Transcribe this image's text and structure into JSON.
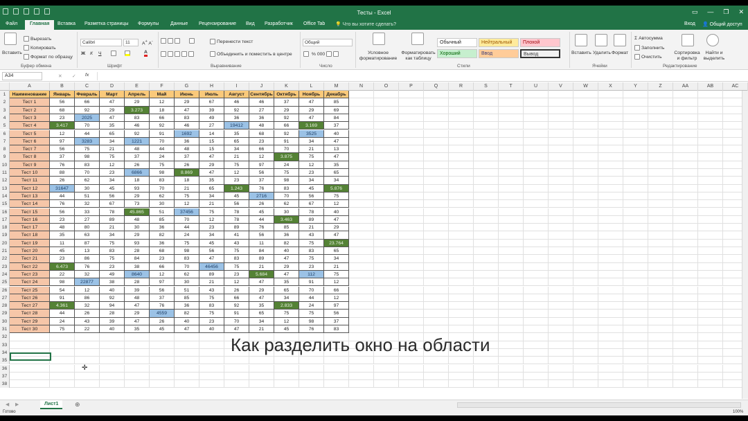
{
  "window": {
    "title": "Тесты - Excel",
    "controls": [
      "▭",
      "—",
      "❐",
      "✕"
    ]
  },
  "tabs": [
    {
      "label": "Файл",
      "active": false
    },
    {
      "label": "Главная",
      "active": true
    },
    {
      "label": "Вставка",
      "active": false
    },
    {
      "label": "Разметка страницы",
      "active": false
    },
    {
      "label": "Формулы",
      "active": false
    },
    {
      "label": "Данные",
      "active": false
    },
    {
      "label": "Рецензирование",
      "active": false
    },
    {
      "label": "Вид",
      "active": false
    },
    {
      "label": "Разработчик",
      "active": false
    },
    {
      "label": "Office Tab",
      "active": false
    }
  ],
  "tell_me": "Что вы хотите сделать?",
  "sign_in": "Вход",
  "share": "Общий доступ",
  "ribbon": {
    "clipboard": {
      "paste": "Вставить",
      "cut": "Вырезать",
      "copy": "Копировать",
      "format_painter": "Формат по образцу",
      "label": "Буфер обмена"
    },
    "font": {
      "name": "Calibri",
      "size": "11",
      "label": "Шрифт"
    },
    "alignment": {
      "wrap": "Перенести текст",
      "merge": "Объединить и поместить в центре",
      "label": "Выравнивание"
    },
    "number": {
      "format": "Общий",
      "label": "Число"
    },
    "styles": {
      "conditional": "Условное форматирование",
      "as_table": "Форматировать как таблицу",
      "label": "Стили",
      "cells": [
        {
          "label": "Обычный",
          "bg": "#ffffff",
          "fg": "#222222"
        },
        {
          "label": "Нейтральный",
          "bg": "#ffeb9c",
          "fg": "#9c5700"
        },
        {
          "label": "Плохой",
          "bg": "#ffc7ce",
          "fg": "#9c0006"
        },
        {
          "label": "Хороший",
          "bg": "#c6efce",
          "fg": "#006100"
        },
        {
          "label": "Ввод",
          "bg": "#ffcc99",
          "fg": "#3f3f76"
        },
        {
          "label": "Вывод",
          "bg": "#f2f2f2",
          "fg": "#3f3f3f"
        }
      ]
    },
    "cells_grp": {
      "insert": "Вставить",
      "delete": "Удалить",
      "format": "Формат",
      "label": "Ячейки"
    },
    "editing": {
      "autosum": "Автосумма",
      "fill": "Заполнить",
      "clear": "Очистить",
      "sort": "Сортировка и фильтр",
      "find": "Найти и выделить",
      "label": "Редактирование"
    }
  },
  "formula_bar": {
    "name_box": "A34",
    "fx": "fx",
    "value": ""
  },
  "columns": [
    "A",
    "B",
    "C",
    "D",
    "E",
    "F",
    "G",
    "H",
    "I",
    "J",
    "K",
    "L",
    "M",
    "N",
    "O",
    "P",
    "Q",
    "R",
    "S",
    "T",
    "U",
    "V",
    "W",
    "X",
    "Y",
    "Z",
    "AA",
    "AB",
    "AC"
  ],
  "table_header": [
    "Наименование",
    "Январь",
    "Февраль",
    "Март",
    "Апрель",
    "Май",
    "Июнь",
    "Июль",
    "Август",
    "Сентябрь",
    "Октябрь",
    "Ноябрь",
    "Декабрь"
  ],
  "table_rows": [
    [
      "Тест 1",
      "56",
      "66",
      "47",
      "29",
      "12",
      "29",
      "67",
      "46",
      "46",
      "37",
      "47",
      "85"
    ],
    [
      "Тест 2",
      "68",
      "92",
      "29",
      "3.273",
      "18",
      "47",
      "39",
      "92",
      "27",
      "29",
      "29",
      "69"
    ],
    [
      "Тест 3",
      "23",
      "2025",
      "47",
      "83",
      "66",
      "83",
      "49",
      "36",
      "36",
      "92",
      "47",
      "84"
    ],
    [
      "Тест 4",
      "3.417",
      "70",
      "35",
      "46",
      "92",
      "46",
      "27",
      "19412",
      "48",
      "66",
      "3.169",
      "37"
    ],
    [
      "Тест 5",
      "12",
      "44",
      "65",
      "92",
      "91",
      "1692",
      "14",
      "35",
      "68",
      "92",
      "3525",
      "40"
    ],
    [
      "Тест 6",
      "97",
      "3283",
      "34",
      "1221",
      "70",
      "36",
      "15",
      "65",
      "23",
      "91",
      "34",
      "47"
    ],
    [
      "Тест 7",
      "56",
      "75",
      "21",
      "48",
      "44",
      "48",
      "15",
      "34",
      "66",
      "70",
      "21",
      "13"
    ],
    [
      "Тест 8",
      "37",
      "98",
      "75",
      "37",
      "24",
      "37",
      "47",
      "21",
      "12",
      "3.875",
      "75",
      "47"
    ],
    [
      "Тест 9",
      "76",
      "83",
      "12",
      "26",
      "75",
      "26",
      "29",
      "75",
      "97",
      "24",
      "12",
      "35"
    ],
    [
      "Тест 10",
      "88",
      "70",
      "23",
      "6866",
      "98",
      "8.869",
      "47",
      "12",
      "56",
      "75",
      "23",
      "65"
    ],
    [
      "Тест 11",
      "26",
      "62",
      "34",
      "18",
      "83",
      "18",
      "35",
      "23",
      "37",
      "98",
      "34",
      "34"
    ],
    [
      "Тест 12",
      "31647",
      "30",
      "45",
      "93",
      "70",
      "21",
      "65",
      "1.243",
      "76",
      "83",
      "45",
      "5.876"
    ],
    [
      "Тест 13",
      "44",
      "51",
      "56",
      "29",
      "62",
      "75",
      "34",
      "45",
      "2716",
      "70",
      "56",
      "75"
    ],
    [
      "Тест 14",
      "76",
      "32",
      "67",
      "73",
      "30",
      "12",
      "21",
      "56",
      "26",
      "62",
      "67",
      "12"
    ],
    [
      "Тест 15",
      "56",
      "33",
      "78",
      "45.865",
      "51",
      "37456",
      "75",
      "78",
      "45",
      "30",
      "78",
      "40"
    ],
    [
      "Тест 16",
      "23",
      "27",
      "89",
      "48",
      "85",
      "70",
      "12",
      "78",
      "44",
      "3.463",
      "89",
      "47"
    ],
    [
      "Тест 17",
      "48",
      "80",
      "21",
      "30",
      "36",
      "44",
      "23",
      "89",
      "76",
      "85",
      "21",
      "29"
    ],
    [
      "Тест 18",
      "35",
      "63",
      "34",
      "29",
      "82",
      "24",
      "34",
      "41",
      "56",
      "36",
      "43",
      "47"
    ],
    [
      "Тест 19",
      "11",
      "87",
      "75",
      "93",
      "36",
      "75",
      "45",
      "43",
      "11",
      "82",
      "75",
      "23.764"
    ],
    [
      "Тест 20",
      "45",
      "13",
      "83",
      "28",
      "68",
      "98",
      "56",
      "75",
      "84",
      "40",
      "83",
      "65"
    ],
    [
      "Тест 21",
      "23",
      "86",
      "75",
      "84",
      "23",
      "83",
      "47",
      "83",
      "89",
      "47",
      "75",
      "34"
    ],
    [
      "Тест 22",
      "6.473",
      "76",
      "23",
      "38",
      "66",
      "70",
      "46456",
      "75",
      "21",
      "29",
      "23",
      "21"
    ],
    [
      "Тест 23",
      "22",
      "32",
      "49",
      "8640",
      "12",
      "62",
      "89",
      "23",
      "5.684",
      "47",
      "112",
      "75"
    ],
    [
      "Тест 24",
      "98",
      "22877",
      "38",
      "28",
      "97",
      "30",
      "21",
      "12",
      "47",
      "35",
      "91",
      "12"
    ],
    [
      "Тест 25",
      "54",
      "12",
      "40",
      "39",
      "56",
      "51",
      "43",
      "26",
      "29",
      "65",
      "70",
      "66"
    ],
    [
      "Тест 26",
      "91",
      "86",
      "92",
      "48",
      "37",
      "85",
      "75",
      "66",
      "47",
      "34",
      "44",
      "12"
    ],
    [
      "Тест 27",
      "4.361",
      "32",
      "94",
      "47",
      "76",
      "36",
      "83",
      "92",
      "35",
      "2.833",
      "24",
      "97"
    ],
    [
      "Тест 28",
      "44",
      "26",
      "28",
      "29",
      "4559",
      "82",
      "75",
      "91",
      "65",
      "75",
      "75",
      "56"
    ],
    [
      "Тест 29",
      "24",
      "43",
      "39",
      "47",
      "26",
      "40",
      "23",
      "70",
      "34",
      "12",
      "98",
      "37"
    ],
    [
      "Тест 30",
      "75",
      "22",
      "40",
      "35",
      "45",
      "47",
      "40",
      "47",
      "21",
      "45",
      "76",
      "83"
    ]
  ],
  "highlights": {
    "green": [
      "2-4",
      "4-1",
      "4-11",
      "8-10",
      "10-6",
      "12-8",
      "12-12",
      "15-4",
      "16-10",
      "19-12",
      "22-1",
      "23-9",
      "27-1",
      "27-10"
    ],
    "blue": [
      "3-2",
      "4-8",
      "5-6",
      "5-11",
      "6-2",
      "6-4",
      "10-4",
      "12-1",
      "13-9",
      "15-6",
      "22-7",
      "23-4",
      "23-11",
      "24-2",
      "28-5"
    ]
  },
  "caption": "Как разделить окно на области",
  "sheet_tab": "Лист1",
  "status": {
    "ready": "Готово",
    "zoom": "100%"
  }
}
